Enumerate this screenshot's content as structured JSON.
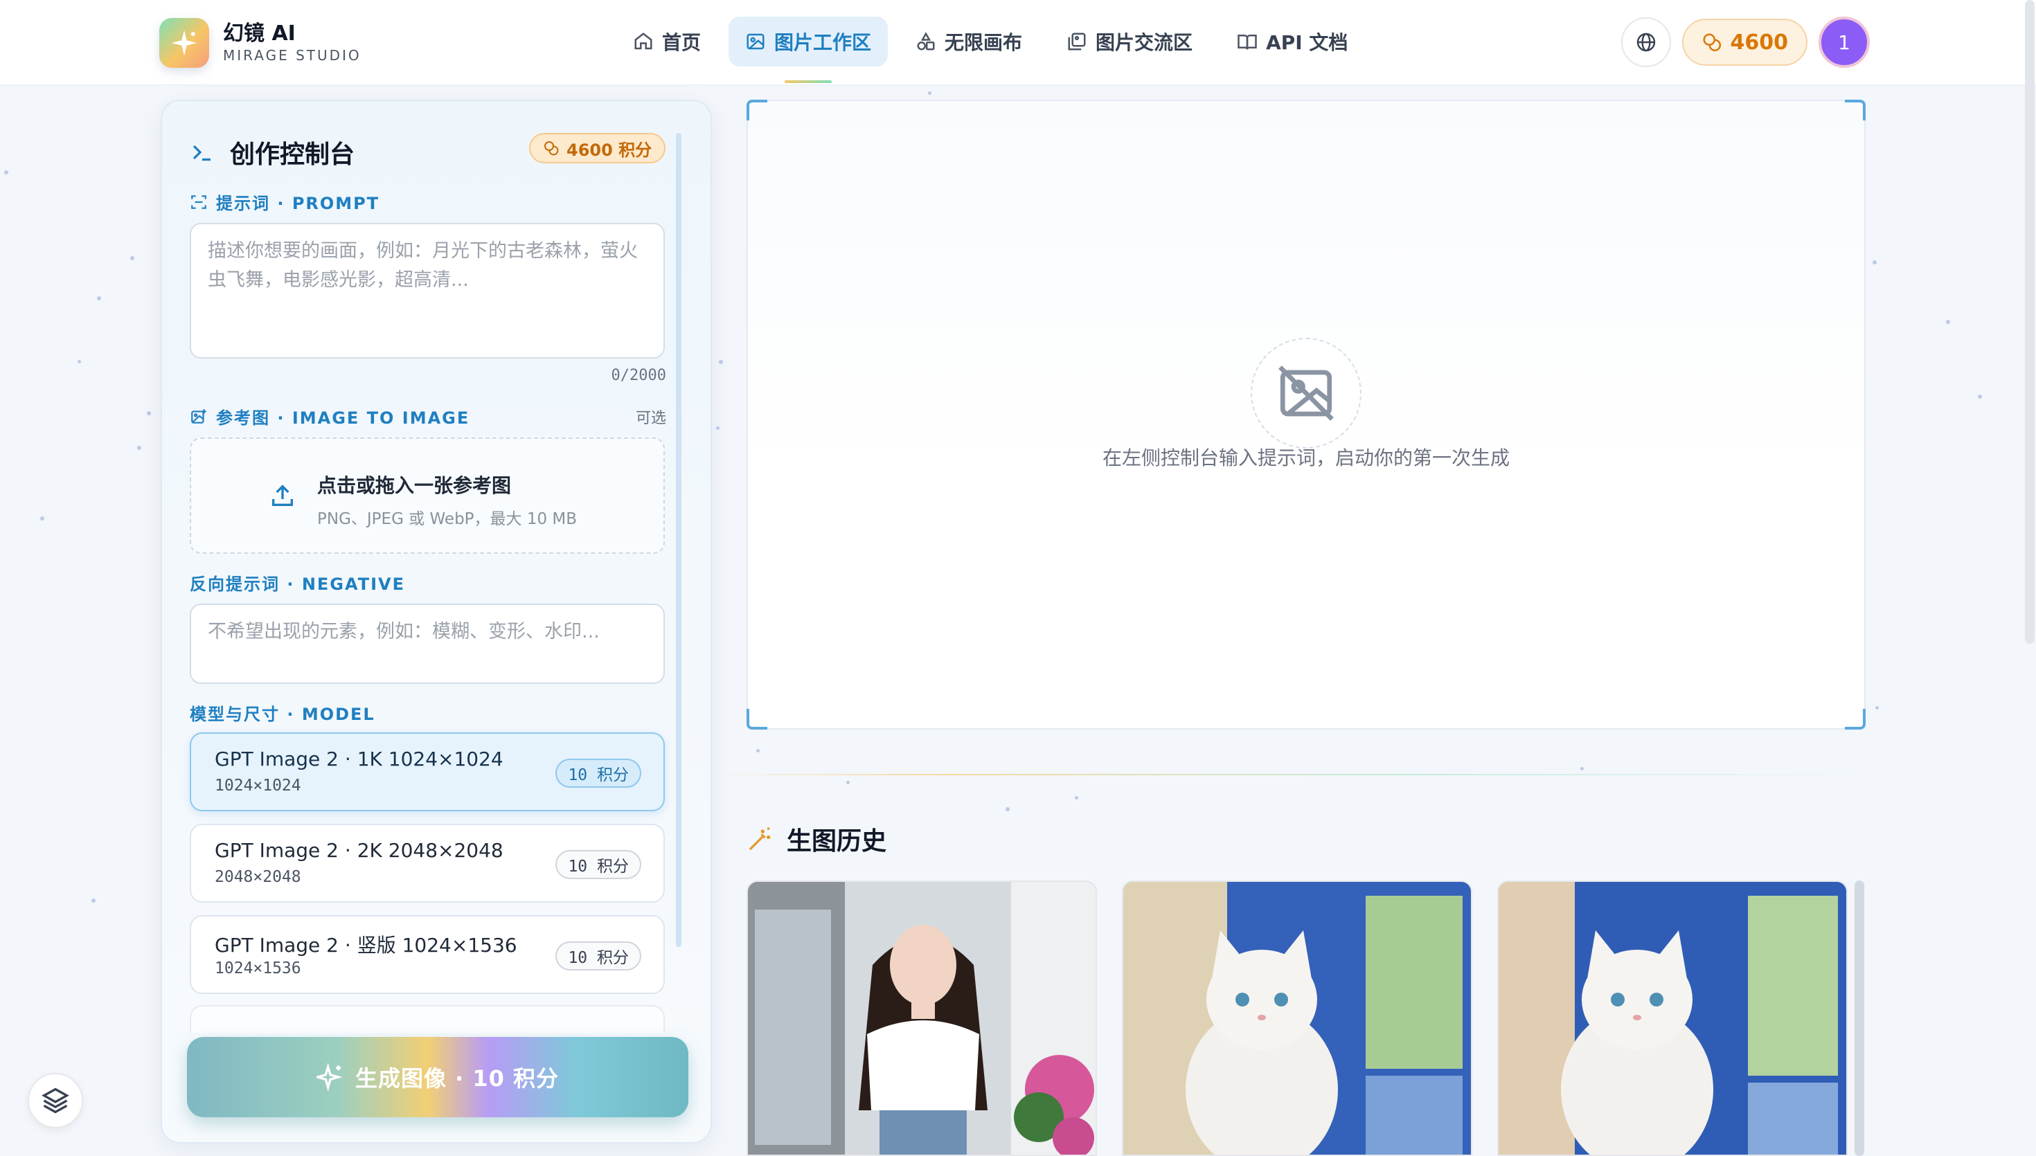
{
  "brand": {
    "name": "幻镜 AI",
    "subtitle": "MIRAGE STUDIO"
  },
  "nav": {
    "items": [
      {
        "label": "首页",
        "icon": "home-icon"
      },
      {
        "label": "图片工作区",
        "icon": "image-icon",
        "active": true
      },
      {
        "label": "无限画布",
        "icon": "shapes-icon"
      },
      {
        "label": "图片交流区",
        "icon": "gallery-icon"
      },
      {
        "label": "API 文档",
        "icon": "book-icon"
      }
    ]
  },
  "header": {
    "credits": "4600",
    "avatar_initial": "1"
  },
  "panel": {
    "title": "创作控制台",
    "credits_badge": "4600 积分",
    "prompt": {
      "label": "提示词 · PROMPT",
      "placeholder": "描述你想要的画面，例如：月光下的古老森林，萤火虫飞舞，电影感光影，超高清...",
      "counter": "0/2000"
    },
    "reference": {
      "label": "参考图 · IMAGE TO IMAGE",
      "optional": "可选",
      "upload_title": "点击或拖入一张参考图",
      "upload_hint": "PNG、JPEG 或 WebP，最大 10 MB"
    },
    "negative": {
      "label": "反向提示词 · NEGATIVE",
      "placeholder": "不希望出现的元素，例如：模糊、变形、水印..."
    },
    "model": {
      "label": "模型与尺寸 · MODEL",
      "options": [
        {
          "name": "GPT Image 2 · 1K 1024×1024",
          "size": "1024×1024",
          "cost": "10 积分",
          "selected": true
        },
        {
          "name": "GPT Image 2 · 2K 2048×2048",
          "size": "2048×2048",
          "cost": "10 积分"
        },
        {
          "name": "GPT Image 2 · 竖版 1024×1536",
          "size": "1024×1536",
          "cost": "10 积分"
        }
      ]
    },
    "generate_label": "生成图像 · 10 积分"
  },
  "preview": {
    "empty_text": "在左侧控制台输入提示词，启动你的第一次生成"
  },
  "history": {
    "title": "生图历史"
  },
  "colors": {
    "accent": "#1f7fc1",
    "credit": "#d97706",
    "avatar": "#8b5cf6"
  }
}
